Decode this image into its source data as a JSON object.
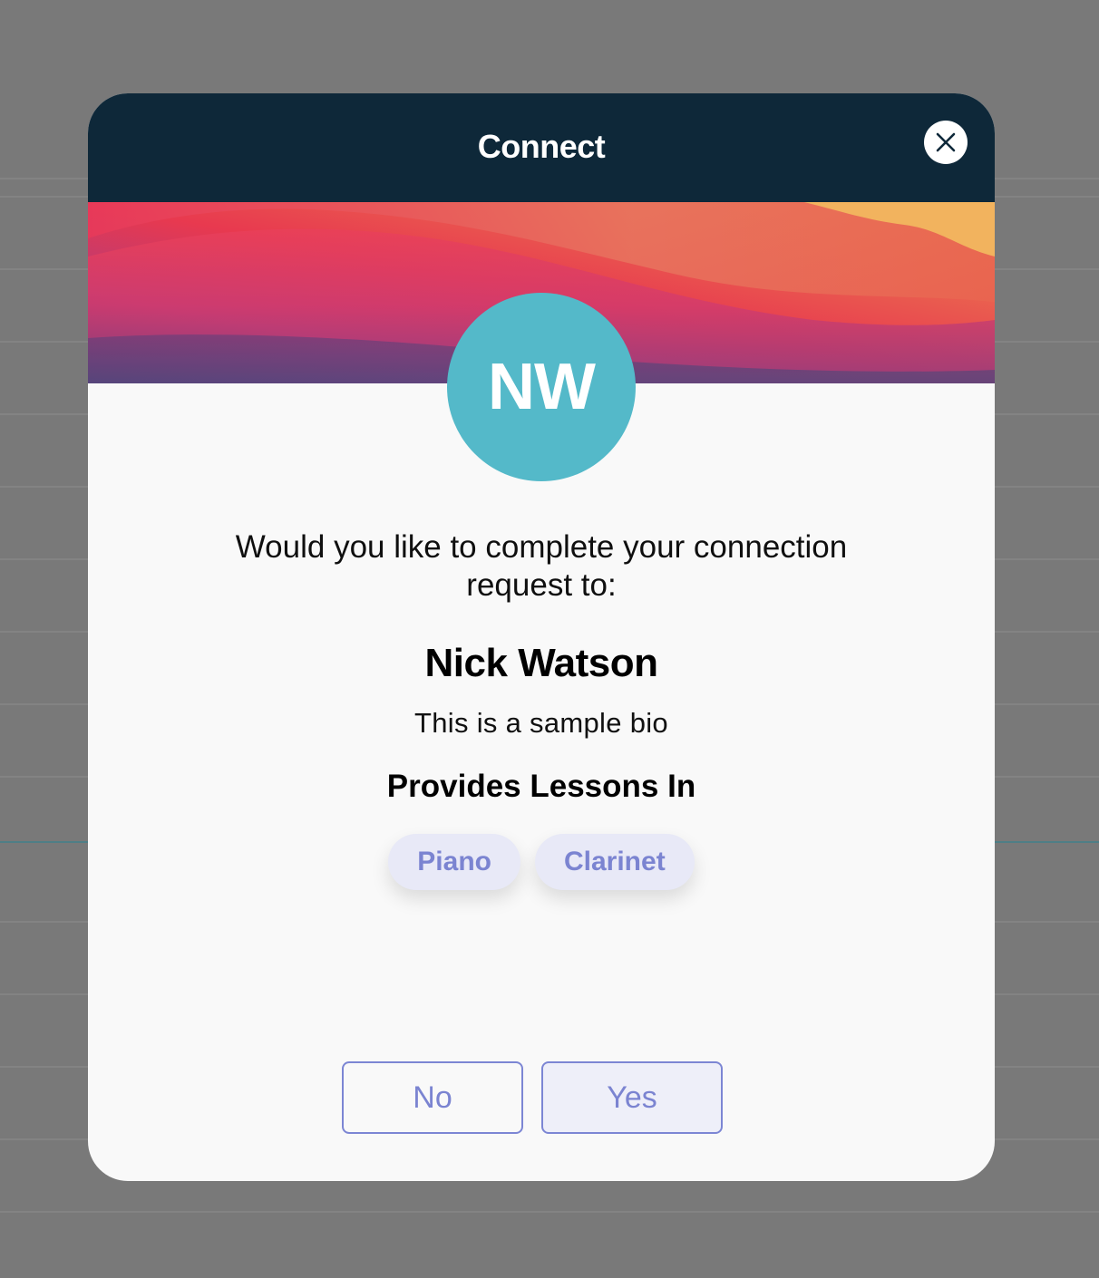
{
  "modal": {
    "title": "Connect",
    "close_icon": "close-icon"
  },
  "profile": {
    "initials": "NW",
    "avatar_color": "#54b9c9",
    "prompt": "Would you like to complete your connection request to:",
    "name": "Nick Watson",
    "bio": "This is a sample bio",
    "lessons_heading": "Provides Lessons In",
    "lessons": [
      "Piano",
      "Clarinet"
    ]
  },
  "actions": {
    "no_label": "No",
    "yes_label": "Yes"
  },
  "colors": {
    "header": "#0e2839",
    "accent": "#7b84d1",
    "overlay": "#797979"
  }
}
